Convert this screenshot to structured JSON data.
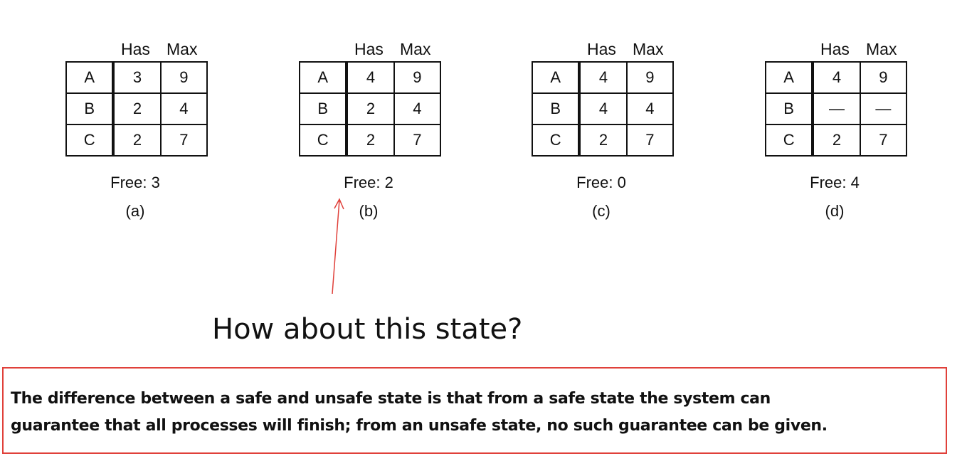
{
  "panels": [
    {
      "header_has": "Has",
      "header_max": "Max",
      "rows": [
        {
          "name": "A",
          "has": "3",
          "max": "9"
        },
        {
          "name": "B",
          "has": "2",
          "max": "4"
        },
        {
          "name": "C",
          "has": "2",
          "max": "7"
        }
      ],
      "free": "Free: 3",
      "label": "(a)"
    },
    {
      "header_has": "Has",
      "header_max": "Max",
      "rows": [
        {
          "name": "A",
          "has": "4",
          "max": "9"
        },
        {
          "name": "B",
          "has": "2",
          "max": "4"
        },
        {
          "name": "C",
          "has": "2",
          "max": "7"
        }
      ],
      "free": "Free: 2",
      "label": "(b)"
    },
    {
      "header_has": "Has",
      "header_max": "Max",
      "rows": [
        {
          "name": "A",
          "has": "4",
          "max": "9"
        },
        {
          "name": "B",
          "has": "4",
          "max": "4"
        },
        {
          "name": "C",
          "has": "2",
          "max": "7"
        }
      ],
      "free": "Free: 0",
      "label": "(c)"
    },
    {
      "header_has": "Has",
      "header_max": "Max",
      "rows": [
        {
          "name": "A",
          "has": "4",
          "max": "9"
        },
        {
          "name": "B",
          "has": "—",
          "max": "—"
        },
        {
          "name": "C",
          "has": "2",
          "max": "7"
        }
      ],
      "free": "Free: 4",
      "label": "(d)"
    }
  ],
  "annotation": {
    "question": "How about this state?",
    "arrow_color": "#e0403a"
  },
  "note": {
    "line1": "The difference between a safe and unsafe state is that from a safe state the system can",
    "line2": "guarantee that all processes will finish; from an unsafe state, no such guarantee can be given.",
    "border_color": "#e0403a"
  }
}
